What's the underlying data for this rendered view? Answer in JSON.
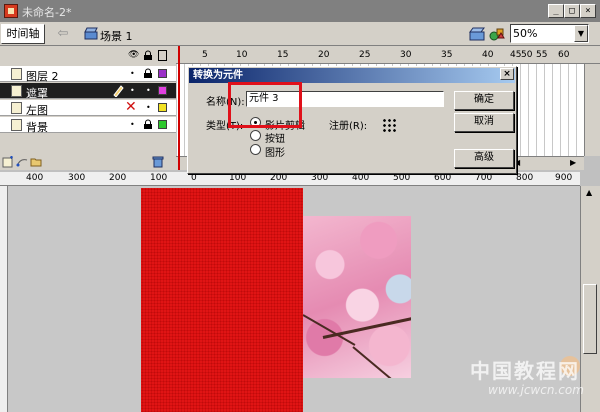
{
  "window": {
    "title": "未命名-2*"
  },
  "timeline": {
    "tab_label": "时间轴",
    "scene_label": "场景 1",
    "zoom": "50%",
    "frame_numbers": [
      "5",
      "10",
      "15",
      "20",
      "25",
      "30",
      "35",
      "40",
      "45",
      "50",
      "55",
      "60"
    ]
  },
  "layers": [
    {
      "name": "图层 2",
      "color": "#9b30c8",
      "selected": false
    },
    {
      "name": "遮罩",
      "color": "#e040e0",
      "selected": true
    },
    {
      "name": "左图",
      "color": "#f2e224",
      "selected": false
    },
    {
      "name": "背景",
      "color": "#2ec82e",
      "selected": false
    }
  ],
  "dialog": {
    "title": "转换为元件",
    "name_label": "名称(N):",
    "name_value": "元件 3",
    "type_label": "类型(T):",
    "type_options": [
      "影片剪辑",
      "按钮",
      "图形"
    ],
    "selected_type": "影片剪辑",
    "registration_label": "注册(R):",
    "ok_label": "确定",
    "cancel_label": "取消",
    "advanced_label": "高级"
  },
  "stage": {
    "ruler_numbers": [
      "400",
      "300",
      "200",
      "100",
      "0",
      "100",
      "200",
      "300",
      "400",
      "500",
      "600",
      "700",
      "800",
      "900"
    ]
  },
  "watermark": {
    "text": "中国教程网",
    "url": "www.jcwcn.com"
  }
}
